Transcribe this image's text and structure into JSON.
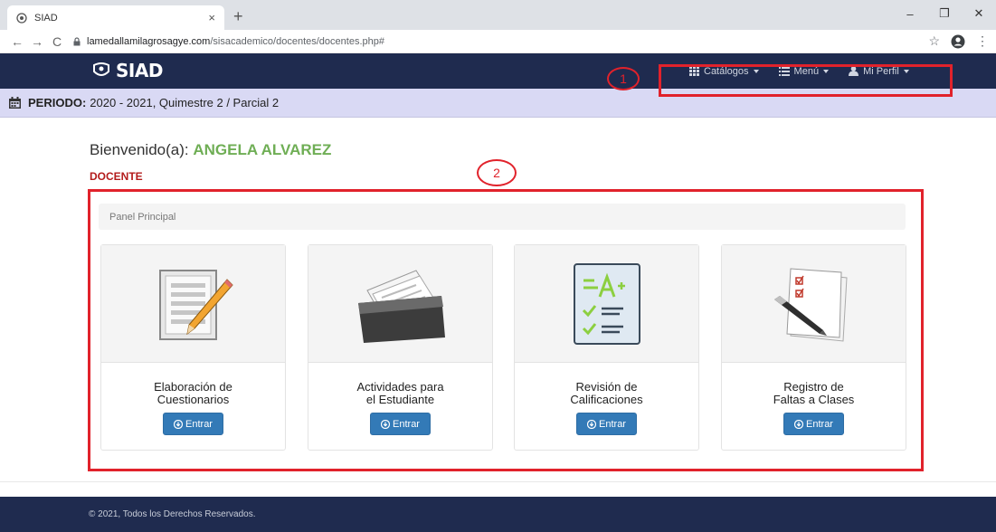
{
  "browser": {
    "tab_title": "SIAD",
    "tab_close": "×",
    "new_tab": "+",
    "url_host": "lamedallamilagrosagye.com",
    "url_path": "/sisacademico/docentes/docentes.php#",
    "back": "←",
    "forward": "→",
    "reload": "C",
    "star": "☆",
    "menu": "⋮",
    "win_min": "–",
    "win_restore": "❐",
    "win_close": "✕"
  },
  "navbar": {
    "brand": "SIAD",
    "catalogos": "Catálogos",
    "menu": "Menú",
    "perfil": "Mi Perfil"
  },
  "annotations": {
    "one": "1",
    "two": "2"
  },
  "period": {
    "label": "PERIODO:",
    "value": "2020 - 2021, Quimestre 2 / Parcial 2"
  },
  "welcome": {
    "prefix": "Bienvenido(a):",
    "name": "ANGELA ALVAREZ",
    "role": "DOCENTE"
  },
  "panel": {
    "heading": "Panel Principal"
  },
  "cards": [
    {
      "line1": "Elaboración de",
      "line2": "Cuestionarios",
      "button": "Entrar"
    },
    {
      "line1": "Actividades para",
      "line2": "el Estudiante",
      "button": "Entrar"
    },
    {
      "line1": "Revisión de",
      "line2": "Calificaciones",
      "button": "Entrar"
    },
    {
      "line1": "Registro de",
      "line2": "Faltas a Clases",
      "button": "Entrar"
    }
  ],
  "footer": {
    "text": "© 2021, Todos los Derechos Reservados."
  },
  "colors": {
    "navbar": "#1f2b4f",
    "period_bg": "#d9d9f4",
    "name_green": "#6fae55",
    "role_red": "#b31b1b",
    "button_blue": "#337ab7",
    "annotation_red": "#e1222b"
  }
}
